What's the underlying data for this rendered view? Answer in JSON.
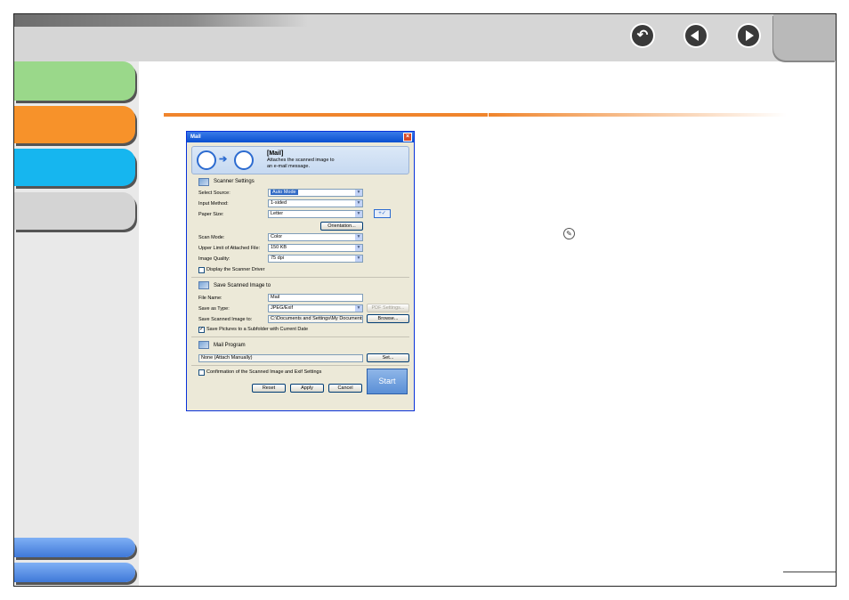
{
  "header": {
    "nav": [
      {
        "name": "back-button",
        "icon": "return-arrow-icon"
      },
      {
        "name": "previous-button",
        "icon": "chevron-left-icon"
      },
      {
        "name": "next-button",
        "icon": "chevron-right-icon"
      }
    ]
  },
  "colors": {
    "accent_orange": "#f0852c",
    "nav_green": "#9ad88a",
    "nav_orange": "#f7922a",
    "nav_cyan": "#16b6ef",
    "nav_gray": "#d4d4d4",
    "nav_blue": "#4a86e8"
  },
  "dialog": {
    "title": "Mail",
    "close": "×",
    "header_title": "[Mail]",
    "header_desc": "Attaches the scanned image to an e-mail message.",
    "scanner_settings": {
      "title": "Scanner Settings",
      "select_source_label": "Select Source:",
      "select_source_value": "Auto Mode",
      "input_method_label": "Input Method:",
      "input_method_value": "1-sided",
      "paper_size_label": "Paper Size:",
      "paper_size_value": "Letter",
      "orientation_button": "Orientation...",
      "scan_mode_label": "Scan Mode:",
      "scan_mode_value": "Color",
      "upper_limit_label": "Upper Limit of Attached File:",
      "upper_limit_value": "150 KB",
      "image_quality_label": "Image Quality:",
      "image_quality_value": "75 dpi",
      "display_driver_label": "Display the Scanner Driver",
      "display_driver_checked": false
    },
    "save_image": {
      "title": "Save Scanned Image to",
      "file_name_label": "File Name:",
      "file_name_value": "Mail",
      "save_type_label": "Save as Type:",
      "save_type_value": "JPEG/Exif",
      "pdf_settings_button": "PDF Settings...",
      "save_to_label": "Save Scanned Image to:",
      "save_to_value": "C:\\Documents and Settings\\My Documents",
      "browse_button": "Browse...",
      "subfolder_label": "Save Pictures to a Subfolder with Current Date",
      "subfolder_checked": true
    },
    "mail_program": {
      "title": "Mail Program",
      "value": "None (Attach Manually)",
      "set_button": "Set..."
    },
    "confirmation_label": "Confirmation of the Scanned Image and Exif Settings",
    "confirmation_checked": false,
    "reset_button": "Reset",
    "apply_button": "Apply",
    "cancel_button": "Cancel",
    "start_button": "Start"
  }
}
